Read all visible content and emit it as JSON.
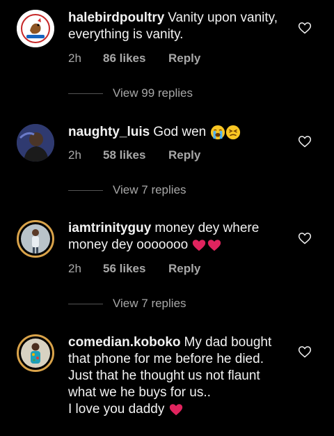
{
  "comments": [
    {
      "username": "halebirdpoultry",
      "text": "Vanity upon vanity, everything is vanity.",
      "time": "2h",
      "likes": "86 likes",
      "reply": "Reply",
      "view_replies": "View 99 replies",
      "avatar_icon": "poultry-logo"
    },
    {
      "username": "naughty_luis",
      "text": "God wen",
      "emojis": [
        "loudly-crying-face",
        "persevering-face"
      ],
      "time": "2h",
      "likes": "58 likes",
      "reply": "Reply",
      "view_replies": "View 7 replies",
      "avatar_icon": "profile-photo"
    },
    {
      "username": "iamtrinityguy",
      "text": "money dey where money dey ooooooo",
      "emojis": [
        "red-heart",
        "red-heart"
      ],
      "time": "2h",
      "likes": "56 likes",
      "reply": "Reply",
      "view_replies": "View 7 replies",
      "avatar_icon": "profile-photo"
    },
    {
      "username": "comedian.koboko",
      "text": "My dad bought that phone for me before he died.",
      "text_line2": "Just that he thought us not flaunt what we he buys for us..",
      "text_line3": "I love you daddy",
      "emojis": [
        "red-heart"
      ],
      "avatar_icon": "profile-photo"
    }
  ],
  "colors": {
    "background": "#000000",
    "text": "#f2f2f2",
    "secondary": "#a8a8a8",
    "story_ring": "#d9a34a",
    "heart_red": "#e0245e"
  }
}
